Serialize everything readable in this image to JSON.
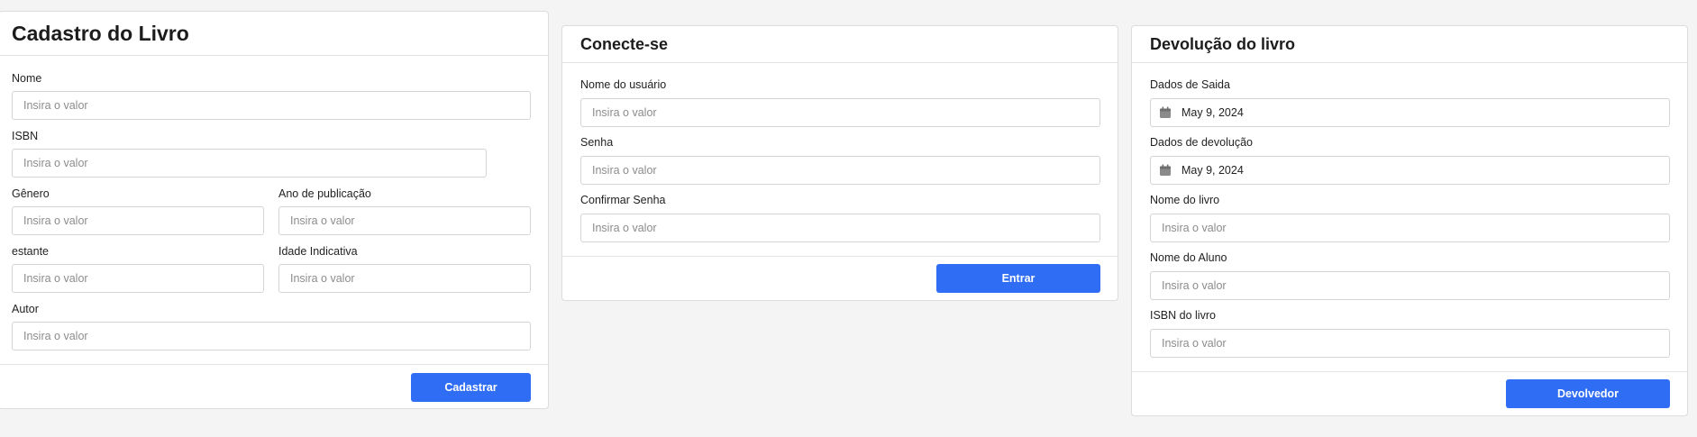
{
  "colors": {
    "primary": "#2f6df5",
    "background": "#f4f4f4",
    "border": "#dcdcdc"
  },
  "cadastro": {
    "title": "Cadastro do Livro",
    "fields": {
      "nome": {
        "label": "Nome",
        "placeholder": "Insira o valor"
      },
      "isbn": {
        "label": "ISBN",
        "placeholder": "Insira o valor"
      },
      "genero": {
        "label": "Gênero",
        "placeholder": "Insira o valor"
      },
      "ano": {
        "label": "Ano de publicação",
        "placeholder": "Insira o valor"
      },
      "estante": {
        "label": "estante",
        "placeholder": "Insira o valor"
      },
      "idade": {
        "label": "Idade Indicativa",
        "placeholder": "Insira o valor"
      },
      "autor": {
        "label": "Autor",
        "placeholder": "Insira o valor"
      }
    },
    "button": "Cadastrar"
  },
  "conecte": {
    "title": "Conecte-se",
    "fields": {
      "usuario": {
        "label": "Nome do usuário",
        "placeholder": "Insira o valor"
      },
      "senha": {
        "label": "Senha",
        "placeholder": "Insira o valor"
      },
      "confirmar": {
        "label": "Confirmar Senha",
        "placeholder": "Insira o valor"
      }
    },
    "button": "Entrar"
  },
  "devolucao": {
    "title": "Devolução do livro",
    "fields": {
      "saida": {
        "label": "Dados de Saida",
        "value": "May 9, 2024",
        "icon": "calendar-icon"
      },
      "devolucao": {
        "label": "Dados de devolução",
        "value": "May 9, 2024",
        "icon": "calendar-icon"
      },
      "livro": {
        "label": "Nome do livro",
        "placeholder": "Insira o valor"
      },
      "aluno": {
        "label": "Nome do Aluno",
        "placeholder": "Insira o valor"
      },
      "isbn": {
        "label": "ISBN do livro",
        "placeholder": "Insira o valor"
      }
    },
    "button": "Devolvedor"
  }
}
